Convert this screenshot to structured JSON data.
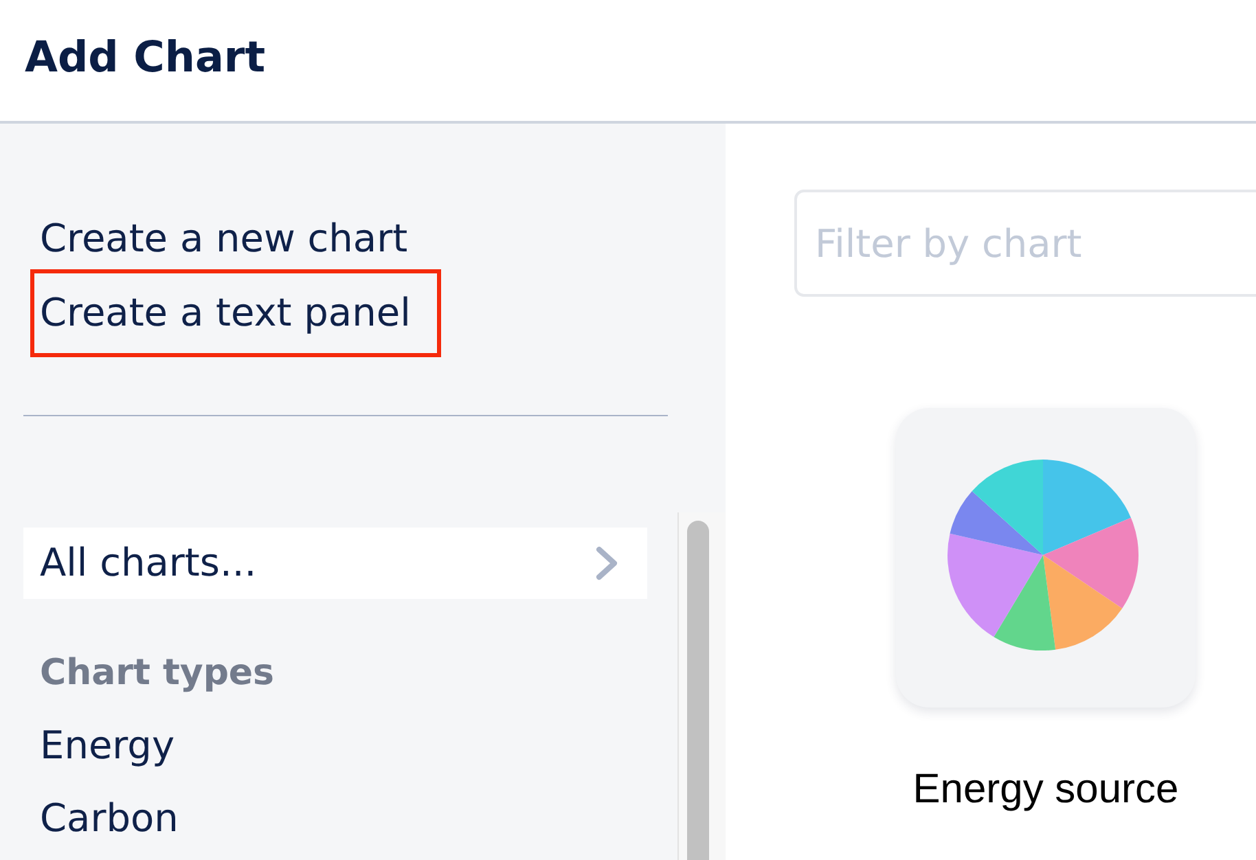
{
  "window": {
    "title": "Add Chart"
  },
  "sidebar": {
    "actions": [
      {
        "label": "Create a new chart",
        "highlighted": false
      },
      {
        "label": "Create a text panel",
        "highlighted": true
      }
    ],
    "all_charts": {
      "label": "All charts..."
    },
    "section_title": "Chart types",
    "items": [
      {
        "label": "Energy"
      },
      {
        "label": "Carbon"
      }
    ]
  },
  "filter": {
    "placeholder": "Filter by chart"
  },
  "charts": [
    {
      "title": "Energy source",
      "kind": "pie"
    }
  ]
}
